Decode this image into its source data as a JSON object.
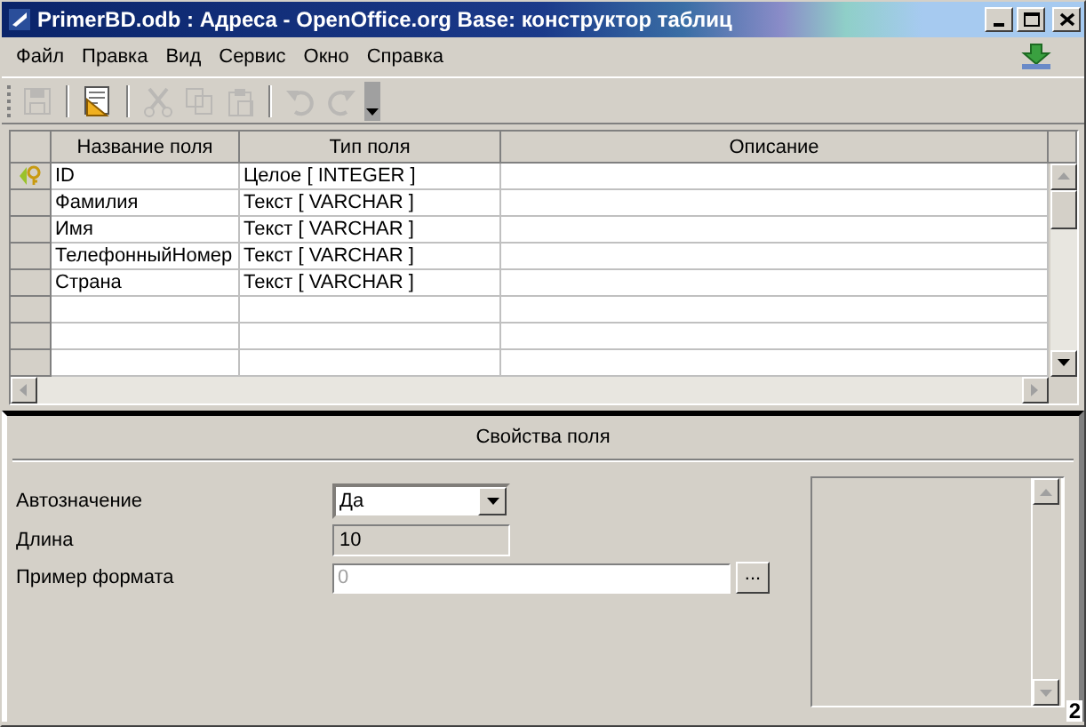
{
  "window": {
    "title": "PrimerBD.odb : Адреса - OpenOffice.org Base: конструктор таблиц"
  },
  "menu": [
    {
      "label": "Файл"
    },
    {
      "label": "Правка"
    },
    {
      "label": "Вид"
    },
    {
      "label": "Сервис"
    },
    {
      "label": "Окно"
    },
    {
      "label": "Справка"
    }
  ],
  "toolbar": [
    {
      "kind": "save",
      "disabled": true
    },
    {
      "kind": "separator"
    },
    {
      "kind": "design",
      "disabled": false
    },
    {
      "kind": "separator"
    },
    {
      "kind": "cut",
      "disabled": true
    },
    {
      "kind": "copy",
      "disabled": true
    },
    {
      "kind": "paste",
      "disabled": true
    },
    {
      "kind": "separator"
    },
    {
      "kind": "undo",
      "disabled": true
    },
    {
      "kind": "redo",
      "disabled": true
    },
    {
      "kind": "overflow"
    }
  ],
  "table": {
    "columns": [
      {
        "label": "Название поля"
      },
      {
        "label": "Тип поля"
      },
      {
        "label": "Описание"
      }
    ],
    "rows": [
      {
        "name": "ID",
        "type": "Целое [ INTEGER ]",
        "primary_key": true
      },
      {
        "name": "Фамилия",
        "type": "Текст [ VARCHAR ]",
        "primary_key": false
      },
      {
        "name": "Имя",
        "type": "Текст [ VARCHAR ]",
        "primary_key": false
      },
      {
        "name": "ТелефонныйНомер",
        "type": "Текст [ VARCHAR ]",
        "primary_key": false
      },
      {
        "name": "Страна",
        "type": "Текст [ VARCHAR ]",
        "primary_key": false
      }
    ]
  },
  "properties": {
    "title": "Свойства поля",
    "fields": [
      {
        "kind": "dropdown",
        "label": "Автозначение",
        "value": "Да"
      },
      {
        "kind": "readonly",
        "label": "Длина",
        "value": "10"
      },
      {
        "kind": "browse",
        "label": "Пример формата",
        "placeholder": "0",
        "button_label": "..."
      }
    ]
  },
  "corner_badge": "2"
}
